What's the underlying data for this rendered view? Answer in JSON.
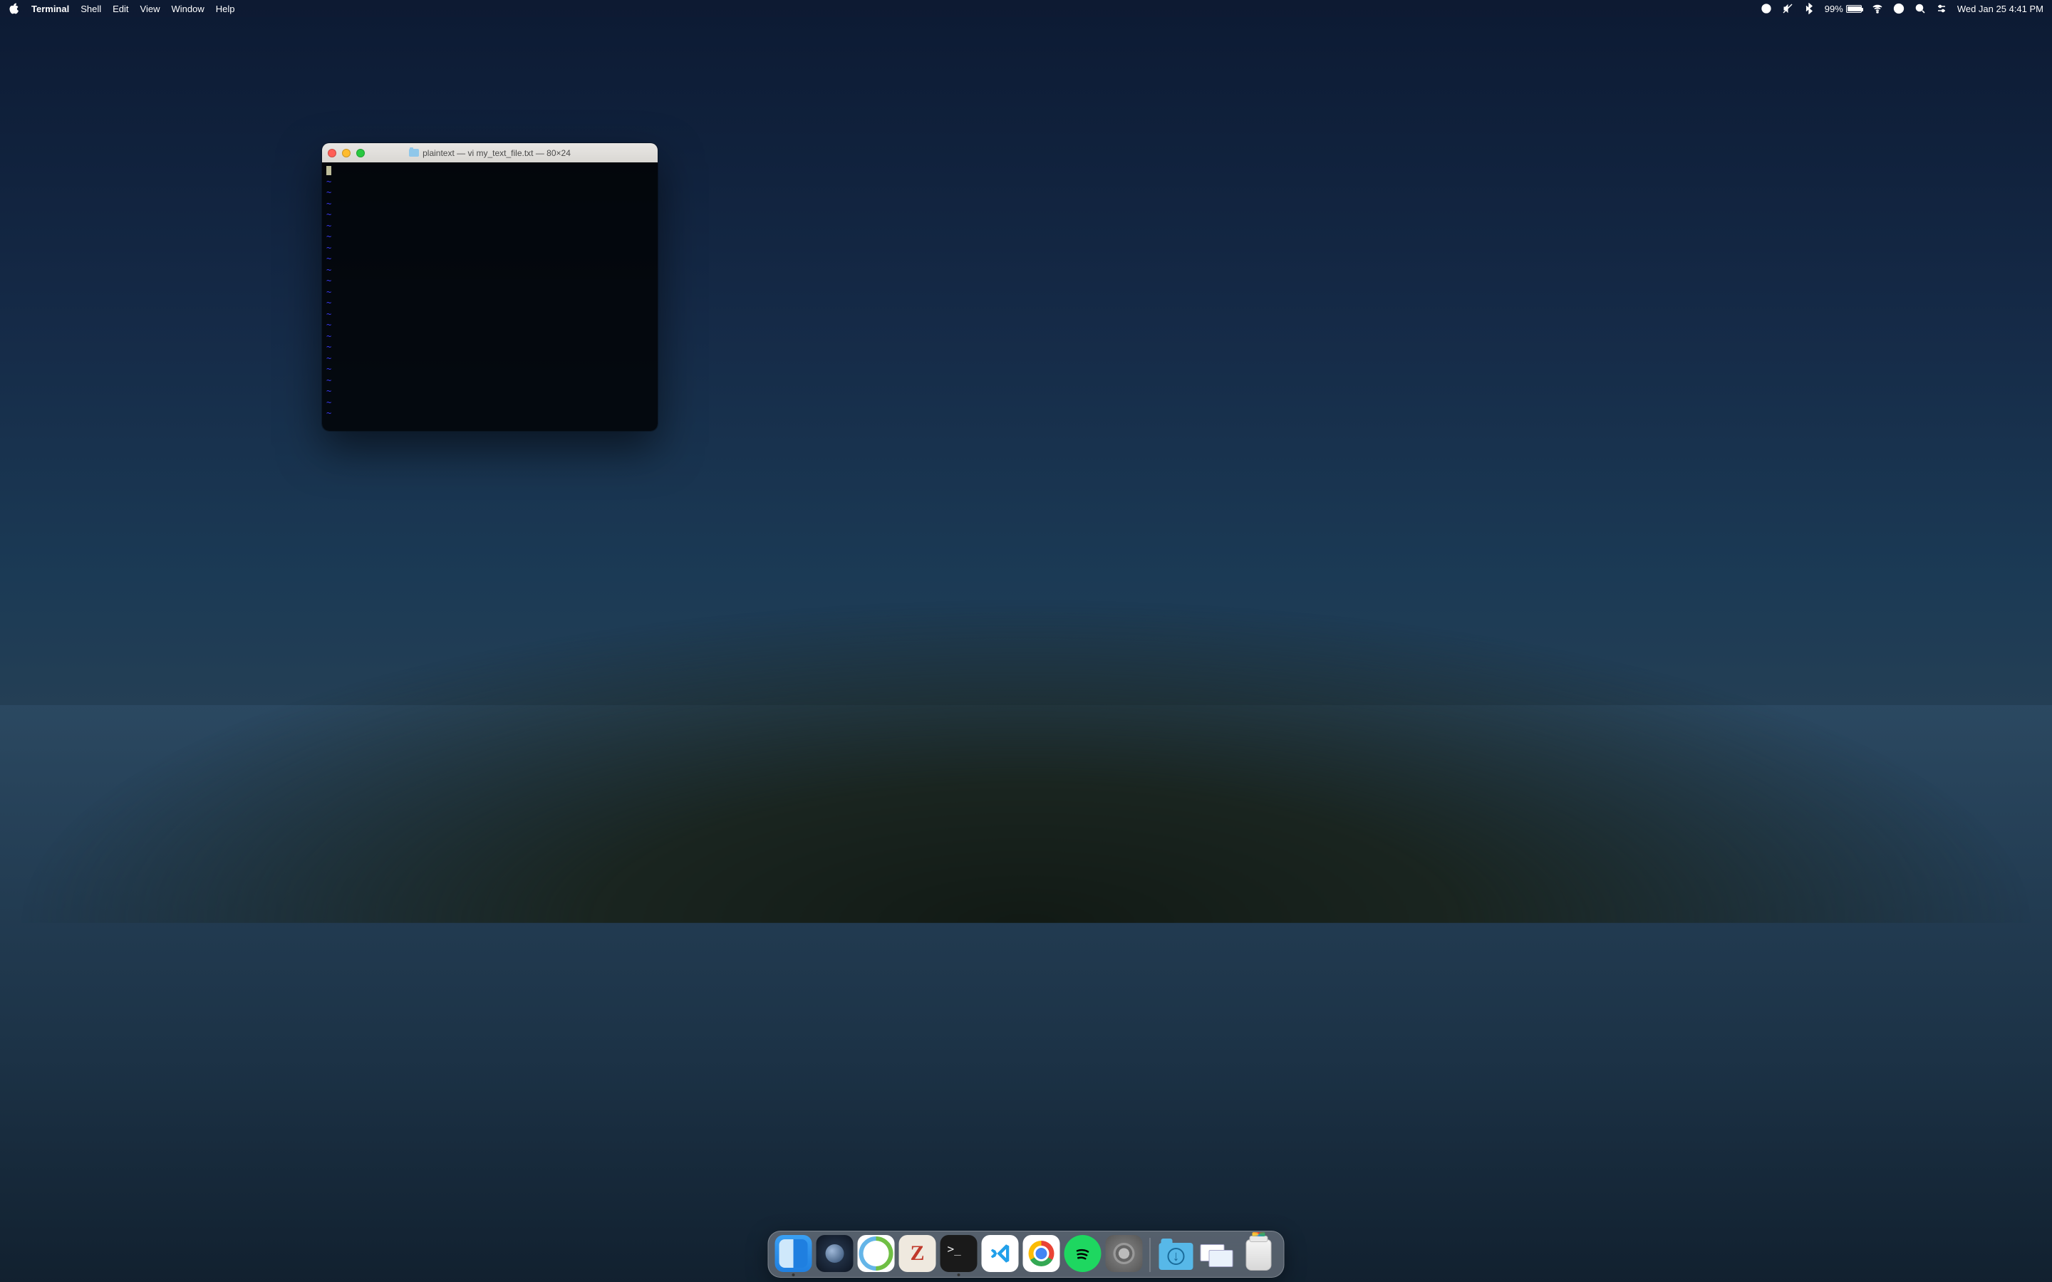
{
  "menubar": {
    "app": "Terminal",
    "items": [
      "Shell",
      "Edit",
      "View",
      "Window",
      "Help"
    ],
    "battery_percent": "99%",
    "clock": "Wed Jan 25  4:41 PM"
  },
  "terminal": {
    "title": "plaintext — vi my_text_file.txt — 80×24",
    "tilde": "~",
    "tilde_rows": 22
  },
  "dock": {
    "apps": [
      {
        "name": "finder",
        "running": true
      },
      {
        "name": "quicktime",
        "running": false
      },
      {
        "name": "cisco-anyconnect",
        "running": false
      },
      {
        "name": "zotero",
        "running": false
      },
      {
        "name": "terminal",
        "running": true
      },
      {
        "name": "vscode",
        "running": false
      },
      {
        "name": "chrome",
        "running": false
      },
      {
        "name": "spotify",
        "running": false
      },
      {
        "name": "system-preferences",
        "running": false
      }
    ],
    "right": [
      {
        "name": "downloads-folder"
      },
      {
        "name": "recent-stack"
      },
      {
        "name": "trash-full"
      }
    ]
  }
}
